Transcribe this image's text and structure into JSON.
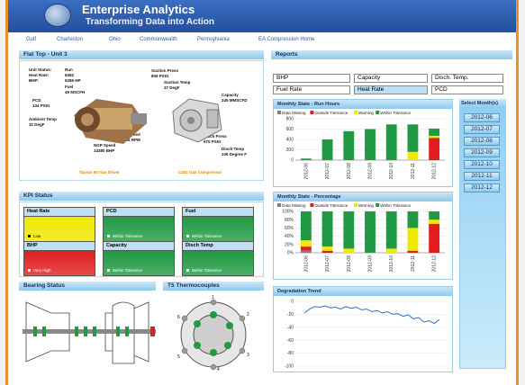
{
  "header": {
    "title": "Enterprise Analytics",
    "subtitle": "Transforming Data into Action"
  },
  "nav": [
    "Gulf",
    "Charleston",
    "Ohio",
    "Commonwealth",
    "Pennsylvania",
    "EA Compression Home"
  ],
  "unit": {
    "panel_title": "Flat Top - Unit 3",
    "status_label": "Unit Status:",
    "status_value": "Run",
    "heat_rate_label": "Heat Rate:",
    "heat_rate_value": "8492",
    "bhp_label": "BHP:",
    "bhp_value": "5285 HP",
    "fuel": "Fuel\n49 MSCFH",
    "pcd": "PCD\n134 PSIG",
    "ambient": "Ambient Temp\n31 DegF",
    "ngp": "NGP Speed\n14380 BHP",
    "npt": "NPT Speed\n12218 RPM",
    "suction_press": "Suction Press\n806 PSIG",
    "suction_temp": "Suction Temp\n37 DegF",
    "capacity": "Capacity\n245 MMSCFD",
    "disch_press": "Disch Press\n970 PSIG",
    "disch_temp": "Disch Temp\n106 Degree F",
    "driver_label": "Taurus 60 Gas Driver",
    "compressor_label": "C402 Gas Compressor"
  },
  "kpi": {
    "panel_title": "KPI Status",
    "tiles": [
      {
        "title": "Heat Rate",
        "value": "Low",
        "color": "#f0e800"
      },
      {
        "title": "PCD",
        "value": "Within Tolerance",
        "color": "#1f9a42"
      },
      {
        "title": "Fuel",
        "value": "Within Tolerance",
        "color": "#1f9a42"
      },
      {
        "title": "BHP",
        "value": "Very High",
        "color": "#e01e1e"
      },
      {
        "title": "Capacity",
        "value": "Within Tolerance",
        "color": "#1f9a42"
      },
      {
        "title": "Disch Temp",
        "value": "Within Tolerance",
        "color": "#1f9a42"
      }
    ]
  },
  "bearing": {
    "panel_title": "Bearing Status"
  },
  "thermo": {
    "panel_title": "T5 Thermocouples",
    "labels": [
      "1",
      "2",
      "3",
      "4",
      "5",
      "6"
    ]
  },
  "reports": {
    "panel_title": "Reports",
    "buttons": [
      "BHP",
      "Capacity",
      "Disch. Temp.",
      "Fuel Rate",
      "Heat Rate",
      "PCD"
    ],
    "month_header": "Select Month(s)",
    "months": [
      "2012-06",
      "2012-07",
      "2012-08",
      "2012-09",
      "2012-10",
      "2012-11",
      "2012-12"
    ]
  },
  "colors": {
    "missing": "#7f7f7f",
    "outside": "#e01e1e",
    "warning": "#f0e800",
    "within": "#1f9a42"
  },
  "chart_data": [
    {
      "type": "bar",
      "title": "Monthly State - Run Hours",
      "categories": [
        "2012-06",
        "2012-07",
        "2012-08",
        "2012-09",
        "2012-10",
        "2012-11",
        "2012-12"
      ],
      "series": [
        {
          "name": "Data Missing",
          "values": [
            0,
            0,
            0,
            0,
            0,
            0,
            0
          ]
        },
        {
          "name": "Outside Tolerance",
          "values": [
            0,
            0,
            0,
            0,
            0,
            0,
            430
          ]
        },
        {
          "name": "Warning",
          "values": [
            0,
            0,
            0,
            0,
            0,
            160,
            40
          ]
        },
        {
          "name": "Within Tolerance",
          "values": [
            30,
            400,
            560,
            600,
            690,
            530,
            140
          ]
        }
      ],
      "ylim": [
        0,
        800
      ],
      "yticks": [
        0,
        200,
        400,
        600,
        800
      ]
    },
    {
      "type": "bar",
      "title": "Monthly State - Percentage",
      "categories": [
        "2012-06",
        "2012-07",
        "2012-08",
        "2012-09",
        "2012-10",
        "2012-11",
        "2012-12"
      ],
      "series": [
        {
          "name": "Data Missing",
          "values": [
            5,
            0,
            0,
            0,
            0,
            0,
            0
          ]
        },
        {
          "name": "Outside Tolerance",
          "values": [
            10,
            5,
            0,
            0,
            0,
            5,
            70
          ]
        },
        {
          "name": "Warning",
          "values": [
            15,
            10,
            10,
            0,
            10,
            55,
            10
          ]
        },
        {
          "name": "Within Tolerance",
          "values": [
            70,
            85,
            90,
            100,
            90,
            40,
            20
          ]
        }
      ],
      "ylim": [
        0,
        100
      ],
      "yticks": [
        "0%",
        "20%",
        "40%",
        "60%",
        "80%",
        "100%"
      ]
    },
    {
      "type": "line",
      "title": "Degradation Trend",
      "values": [
        -18,
        -12,
        -8,
        -9,
        -7,
        -10,
        -9,
        -12,
        -8,
        -11,
        -9,
        -13,
        -12,
        -16,
        -14,
        -18,
        -16,
        -20,
        -19,
        -23,
        -21,
        -27,
        -25,
        -32,
        -30,
        -34,
        -28
      ],
      "ylim": [
        -100,
        0
      ],
      "yticks": [
        0,
        -20,
        -40,
        -60,
        -80,
        -100
      ]
    }
  ]
}
